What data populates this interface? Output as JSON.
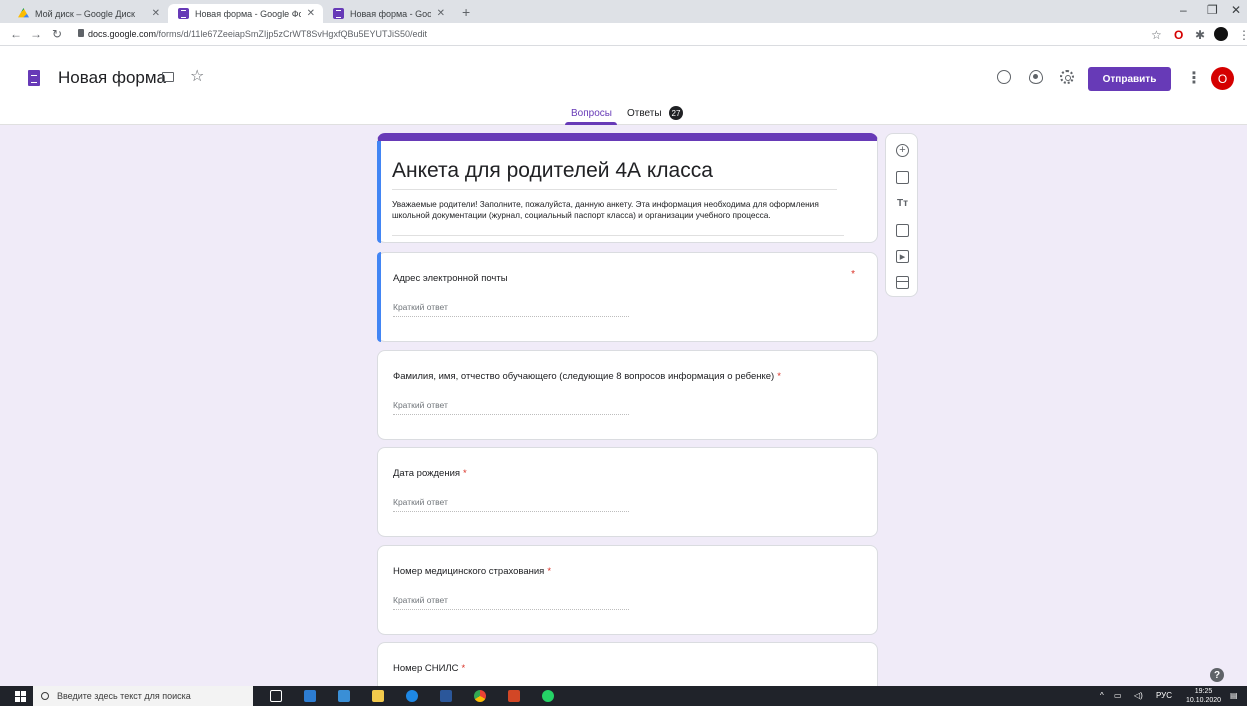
{
  "browser": {
    "tabs": [
      {
        "label": "Мой диск – Google Диск"
      },
      {
        "label": "Новая форма - Google Формы"
      },
      {
        "label": "Новая форма - Google Формы"
      }
    ],
    "tab_close": "✕",
    "new_tab": "+",
    "url_host": "docs.google.com",
    "url_path": "/forms/d/11le67ZeeiapSmZIjp5zCrWT8SvHgxfQBu5EYUTJiS50/edit",
    "window": {
      "minimize": "–",
      "restore": "❐",
      "close": "✕"
    }
  },
  "header": {
    "form_name": "Новая форма",
    "star": "☆",
    "send_label": "Отправить",
    "kebab": "⋮",
    "avatar_letter": "О",
    "tabs": {
      "questions": "Вопросы",
      "answers": "Ответы",
      "answers_count": "27"
    }
  },
  "form": {
    "title": "Анкета для родителей 4А класса",
    "description": "Уважаемые родители! Заполните, пожалуйста, данную анкету. Эта информация необходима для оформления школьной документации (журнал, социальный паспорт класса) и организации учебного процесса.",
    "questions": [
      {
        "title": "Адрес электронной почты",
        "answer_placeholder": "Краткий ответ",
        "required": true
      },
      {
        "title": "Фамилия, имя, отчество обучающего (следующие 8 вопросов информация о ребенке)",
        "answer_placeholder": "Краткий ответ",
        "required": true
      },
      {
        "title": "Дата рождения",
        "answer_placeholder": "Краткий ответ",
        "required": true
      },
      {
        "title": "Номер медицинского страхования",
        "answer_placeholder": "Краткий ответ",
        "required": true
      },
      {
        "title": "Номер СНИЛС",
        "answer_placeholder": "",
        "required": true
      }
    ],
    "required_mark": "*"
  },
  "sidebar_tools": {
    "add": "+",
    "title_text": "Tт"
  },
  "help": "?",
  "taskbar": {
    "search_placeholder": "Введите здесь текст для поиска",
    "lang": "РУС",
    "time": "19:25",
    "date": "10.10.2020"
  }
}
